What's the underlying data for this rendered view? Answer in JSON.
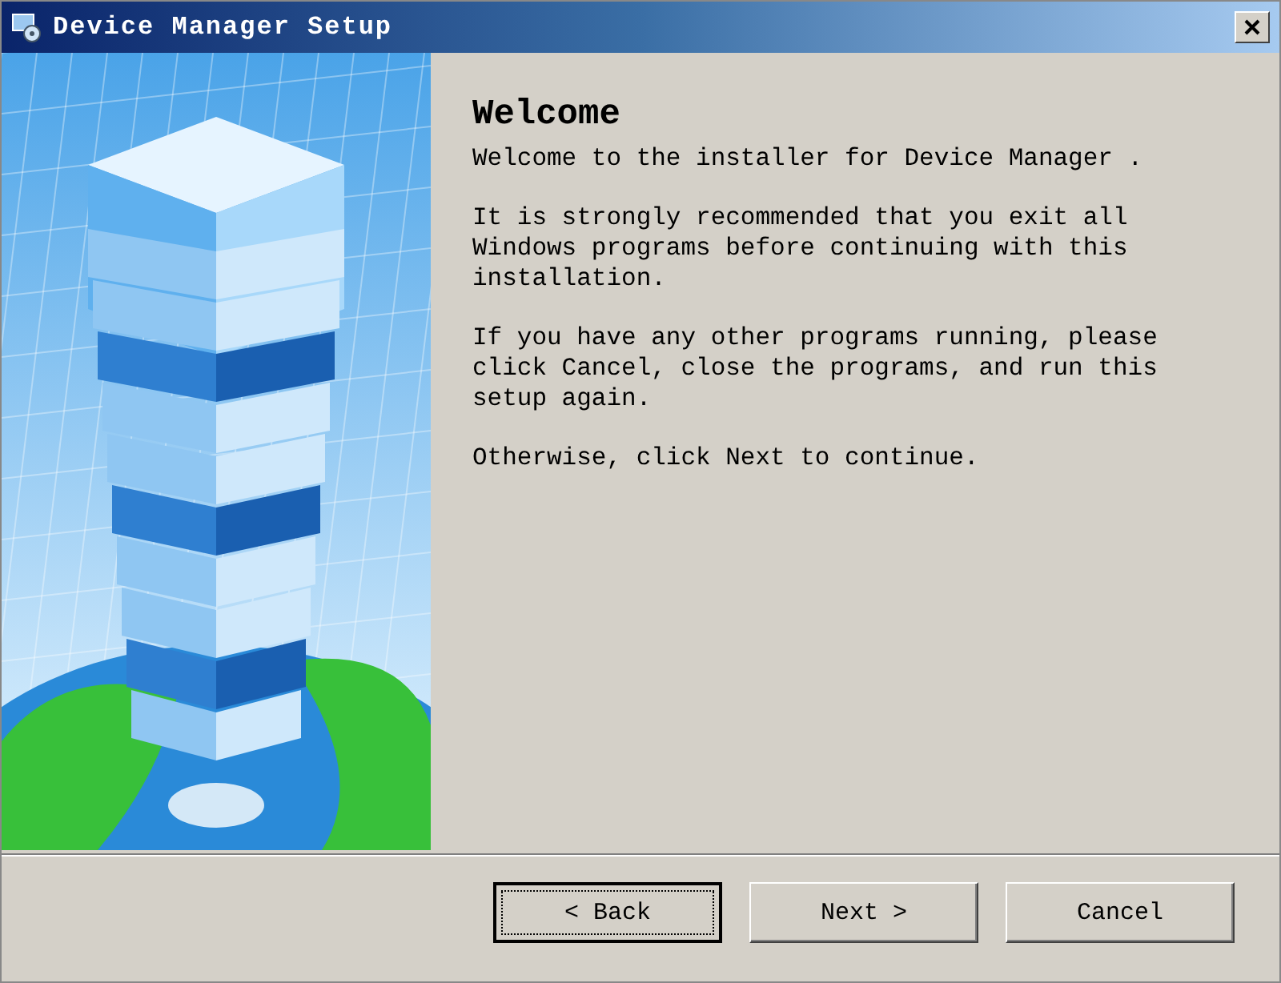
{
  "window": {
    "title": "Device Manager Setup"
  },
  "heading": "Welcome",
  "paragraphs": [
    "Welcome to the installer for Device Manager .",
    "It is strongly recommended that you exit all Windows programs before continuing with this installation.",
    "If you have any other programs running, please click Cancel, close the programs, and run this setup again.",
    "Otherwise, click Next to continue."
  ],
  "buttons": [
    {
      "label": "< Back",
      "focused": true
    },
    {
      "label": "Next >",
      "focused": false
    },
    {
      "label": "Cancel",
      "focused": false
    }
  ]
}
